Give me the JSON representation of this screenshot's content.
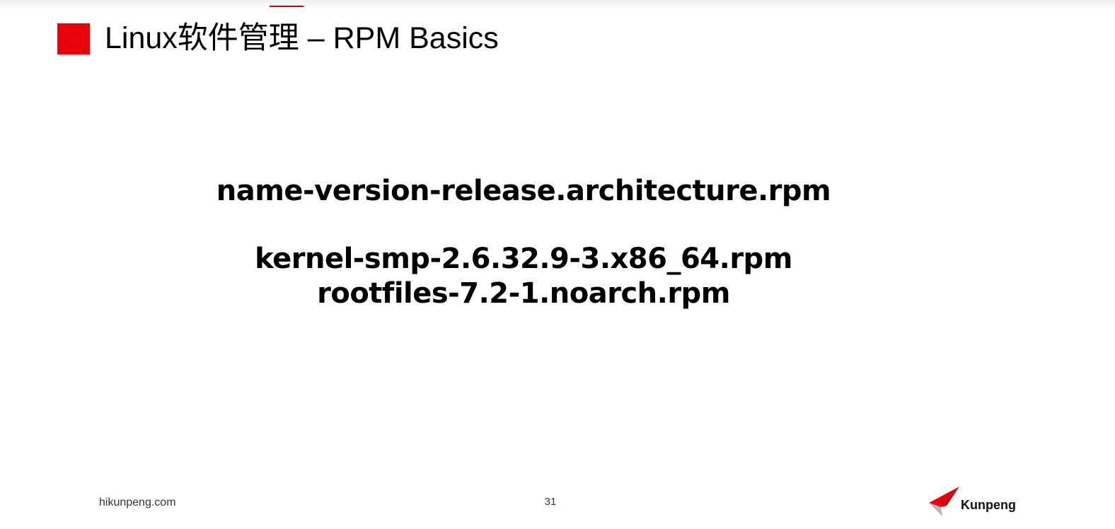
{
  "slide": {
    "title": "Linux软件管理 – RPM Basics",
    "format_line": "name-version-release.architecture.rpm",
    "examples": [
      "kernel-smp-2.6.32.9-3.x86_64.rpm",
      "rootfiles-7.2-1.noarch.rpm"
    ]
  },
  "footer": {
    "site": "hikunpeng.com",
    "page_number": "31",
    "brand": "Kunpeng"
  },
  "colors": {
    "accent": "#e8000b",
    "text": "#000000"
  },
  "icons": {
    "title_marker": "red-square-icon",
    "brand_logo": "kunpeng-wing-logo-icon"
  }
}
